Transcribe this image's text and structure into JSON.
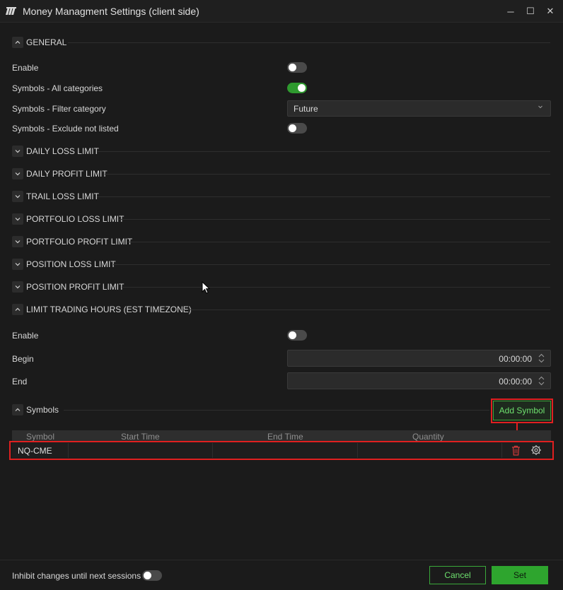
{
  "window": {
    "title": "Money Managment Settings (client side)",
    "minimize_glyph": "─",
    "maximize_glyph": "☐",
    "close_glyph": "✕"
  },
  "general": {
    "title": "GENERAL",
    "expanded": true,
    "enable_label": "Enable",
    "enable_on": false,
    "all_categories_label": "Symbols - All categories",
    "all_categories_on": true,
    "filter_category_label": "Symbols - Filter category",
    "filter_category_value": "Future",
    "exclude_not_listed_label": "Symbols - Exclude not listed",
    "exclude_not_listed_on": false
  },
  "collapsed_sections": [
    "DAILY LOSS LIMIT",
    "DAILY PROFIT LIMIT",
    "TRAIL LOSS LIMIT",
    "PORTFOLIO LOSS LIMIT",
    "PORTFOLIO PROFIT LIMIT",
    "POSITION LOSS LIMIT",
    "POSITION PROFIT LIMIT"
  ],
  "trading_hours": {
    "title": "LIMIT TRADING HOURS (EST TIMEZONE)",
    "expanded": true,
    "enable_label": "Enable",
    "enable_on": false,
    "begin_label": "Begin",
    "begin_value": "00:00:00",
    "end_label": "End",
    "end_value": "00:00:00"
  },
  "symbols": {
    "title": "Symbols",
    "add_button": "Add Symbol",
    "columns": [
      "Symbol",
      "Start Time",
      "End Time",
      "Quantity"
    ],
    "rows": [
      {
        "symbol": "NQ-CME",
        "start_time": "",
        "end_time": "",
        "quantity": ""
      }
    ]
  },
  "footer": {
    "inhibit_label": "Inhibit changes until next sessions",
    "inhibit_on": false,
    "cancel_label": "Cancel",
    "set_label": "Set"
  },
  "colors": {
    "accent_green": "#2ea52e",
    "highlight_red": "#e02020",
    "background": "#1b1b1b"
  },
  "icons": {
    "logo": "app-logo-icon",
    "chevron_up": "chevron-up-icon",
    "chevron_down": "chevron-down-icon",
    "delete": "trash-icon",
    "settings": "gear-icon"
  }
}
